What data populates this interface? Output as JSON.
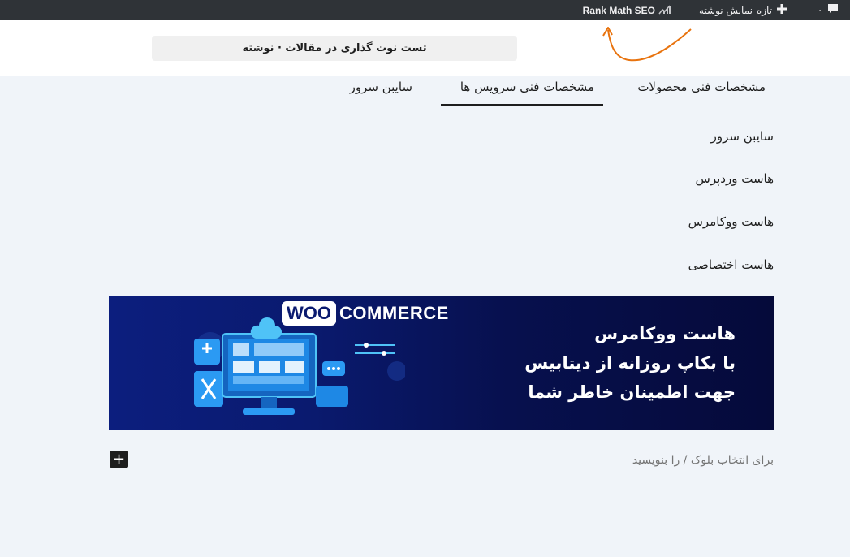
{
  "admin_bar": {
    "comments_count": "۰",
    "new_label": "تازه",
    "view_post_label": "نمایش نوشته",
    "rank_math_label": "Rank Math SEO"
  },
  "editor": {
    "document_title": "تست نوت گذاری در مقالات · نوشته"
  },
  "tabs": [
    {
      "label": "مشخصات فنی محصولات",
      "active": false
    },
    {
      "label": "مشخصات فنی سرویس ها",
      "active": true
    },
    {
      "label": "سایبن سرور",
      "active": false
    }
  ],
  "content_items": [
    "سایبن سرور",
    "هاست وردپرس",
    "هاست ووکامرس",
    "هاست اختصاصی"
  ],
  "banner": {
    "logo_woo": "WOO",
    "logo_commerce": "COMMERCE",
    "line1": "هاست ووکامرس",
    "line2": "با بکاپ روزانه از دیتابیس",
    "line3": "جهت اطمینان خاطر شما"
  },
  "inserter": {
    "placeholder": "برای انتخاب بلوک / را بنویسید"
  },
  "colors": {
    "admin_bar_bg": "#2f3337",
    "canvas_bg": "#f0f4f9",
    "annotation_arrow": "#e8730e",
    "banner_bg": "#0a1a6f"
  }
}
